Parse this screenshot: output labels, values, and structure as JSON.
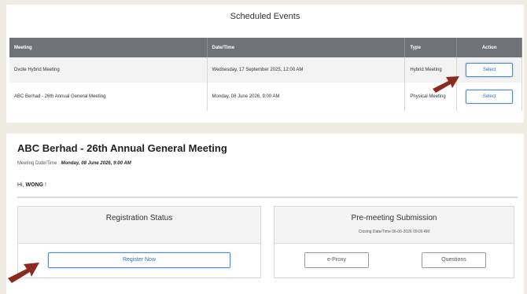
{
  "events": {
    "title": "Scheduled Events",
    "columns": [
      "Meeting",
      "Date/Time",
      "Type",
      "Action"
    ],
    "rows": [
      {
        "meeting": "Dvote Hybrid Meeting",
        "datetime": "Wednesday, 17 September 2025, 12:00 AM",
        "type": "Hybrid Meeting",
        "action": "Select"
      },
      {
        "meeting": "ABC Berhad - 26th Annual General Meeting",
        "datetime": "Monday, 08 June 2026, 9:00 AM",
        "type": "Physical Meeting",
        "action": "Select"
      }
    ]
  },
  "meeting": {
    "title": "ABC Berhad - 26th Annual General Meeting",
    "date_label": "Meeting Date/Time :",
    "date_value": "Monday, 08 June 2026, 9:00 AM",
    "greeting_prefix": "Hi,",
    "user_name": "WONG",
    "greeting_suffix": "!",
    "registration": {
      "title": "Registration Status",
      "button": "Register Now"
    },
    "premeeting": {
      "title": "Pre-meeting Submission",
      "closing": "Closing Date/Time 06-06-2026 09:00 AM",
      "buttons": [
        "e-Proxy",
        "Questions"
      ]
    }
  },
  "colors": {
    "header_bg": "#6f7277",
    "accent_blue": "#4a8fd6",
    "arrow": "#8b2a1e",
    "page_bg": "#efece3"
  }
}
